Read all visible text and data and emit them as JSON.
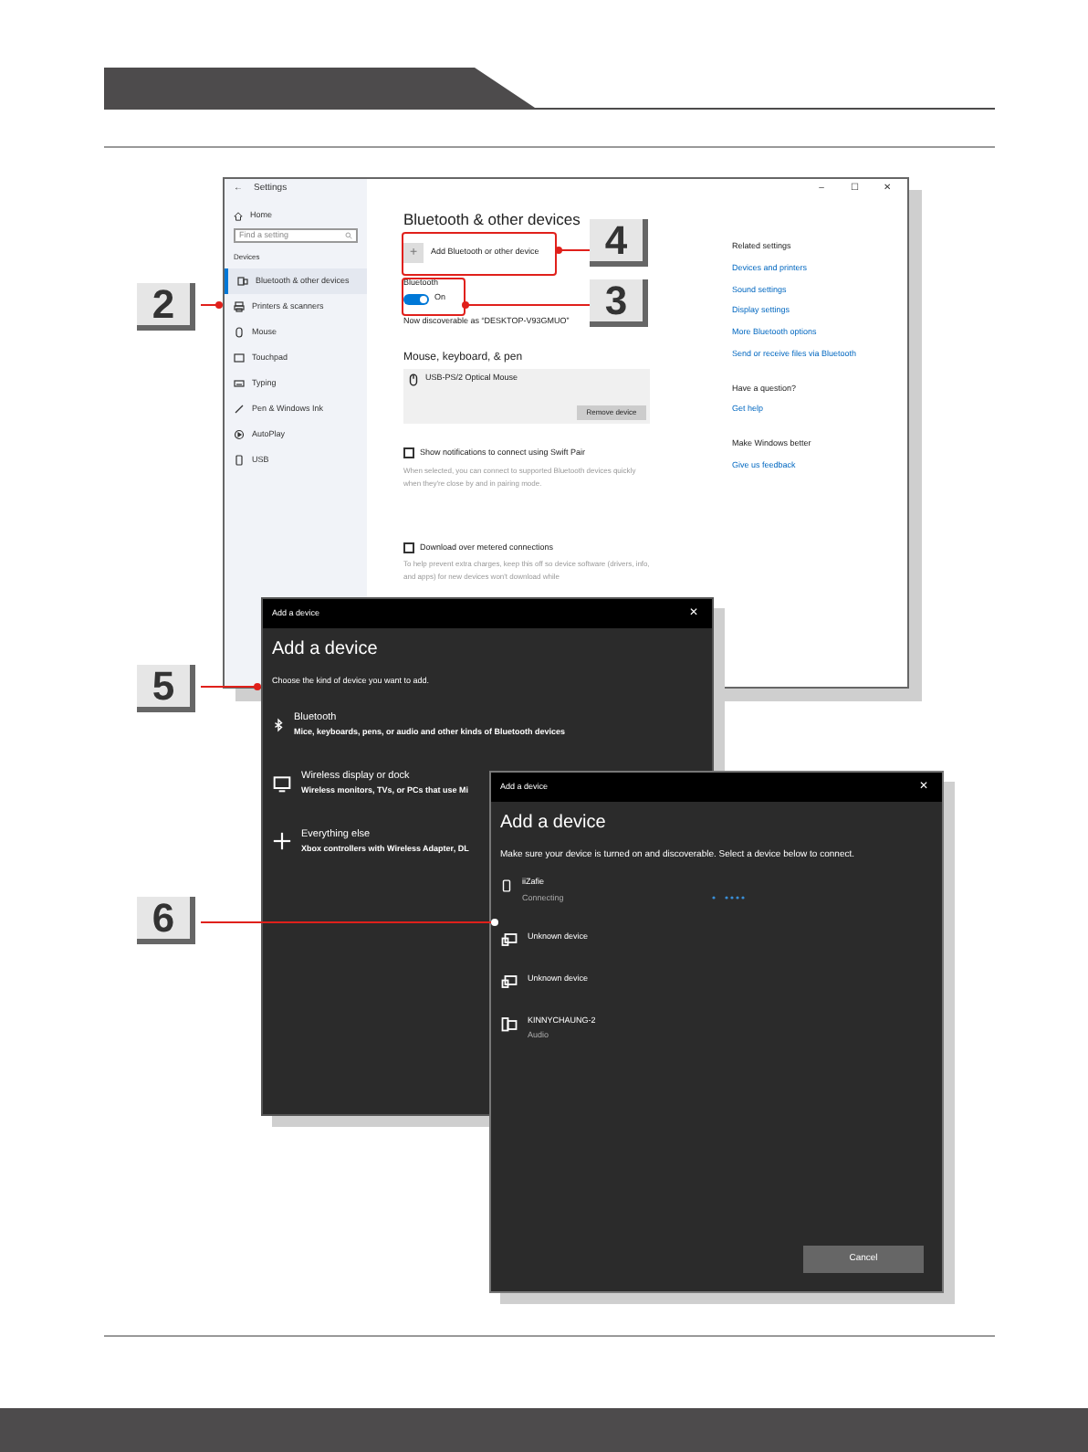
{
  "settings_window": {
    "back": "←",
    "title": "Settings",
    "controls": [
      "–",
      "☐",
      "✕"
    ],
    "sidebar": {
      "home": "Home",
      "search_placeholder": "Find a setting",
      "section": "Devices",
      "items": [
        {
          "label": "Bluetooth & other devices",
          "selected": true
        },
        {
          "label": "Printers & scanners",
          "selected": false
        },
        {
          "label": "Mouse",
          "selected": false
        },
        {
          "label": "Touchpad",
          "selected": false
        },
        {
          "label": "Typing",
          "selected": false
        },
        {
          "label": "Pen & Windows Ink",
          "selected": false
        },
        {
          "label": "AutoPlay",
          "selected": false
        },
        {
          "label": "USB",
          "selected": false
        }
      ]
    },
    "heading": "Bluetooth & other devices",
    "add_button": {
      "icon": "+",
      "label": "Add Bluetooth or other device"
    },
    "bluetooth": {
      "label": "Bluetooth",
      "on": true,
      "state": "On"
    },
    "discoverable": "Now discoverable as “DESKTOP-V93GMUO”",
    "group_heading": "Mouse, keyboard, & pen",
    "device": {
      "name": "USB-PS/2 Optical Mouse",
      "button": "Remove device"
    },
    "options": [
      {
        "label": "Show notifications to connect using Swift Pair",
        "checked": false,
        "description": "When selected, you can connect to supported Bluetooth devices quickly when they're close by and in pairing mode."
      },
      {
        "label": "Download over metered connections",
        "checked": false,
        "description": "To help prevent extra charges, keep this off so device software (drivers, info, and apps) for new devices won't download while"
      }
    ],
    "related": [
      {
        "heading": "Related settings",
        "links": [
          "Devices and printers",
          "Sound settings",
          "Display settings",
          "More Bluetooth options",
          "Send or receive files via Bluetooth"
        ]
      },
      {
        "heading": "Have a question?",
        "links": [
          "Get help"
        ]
      },
      {
        "heading": "Make Windows better",
        "links": [
          "Give us feedback"
        ]
      }
    ]
  },
  "kind_dialog": {
    "title": "Add a device",
    "close": "✕",
    "heading": "Add a device",
    "prompt": "Choose the kind of device you want to add.",
    "choices": [
      {
        "kind": "bluetooth",
        "label": "Bluetooth",
        "description": "Mice, keyboards, pens, or audio and other kinds of Bluetooth devices"
      },
      {
        "kind": "display",
        "label": "Wireless display or dock",
        "description": "Wireless monitors, TVs, or PCs that use Mi"
      },
      {
        "kind": "other",
        "label": "Everything else",
        "description": "Xbox controllers with Wireless Adapter, DL"
      }
    ]
  },
  "device_dialog": {
    "title": "Add a device",
    "close": "✕",
    "heading": "Add a device",
    "prompt": "Make sure your device is turned on and discoverable. Select a device below to connect.",
    "devices": [
      {
        "kind": "phone",
        "name": "iiZafie",
        "status": "Connecting",
        "busy": true
      },
      {
        "kind": "unknown",
        "name": "Unknown device",
        "busy": false
      },
      {
        "kind": "unknown",
        "name": "Unknown device",
        "busy": false
      },
      {
        "kind": "computer",
        "name": "KINNYCHAUNG-2",
        "status": "Audio",
        "busy": false
      }
    ],
    "cancel": "Cancel"
  },
  "callouts": [
    "4",
    "2",
    "3",
    "5",
    "6"
  ]
}
